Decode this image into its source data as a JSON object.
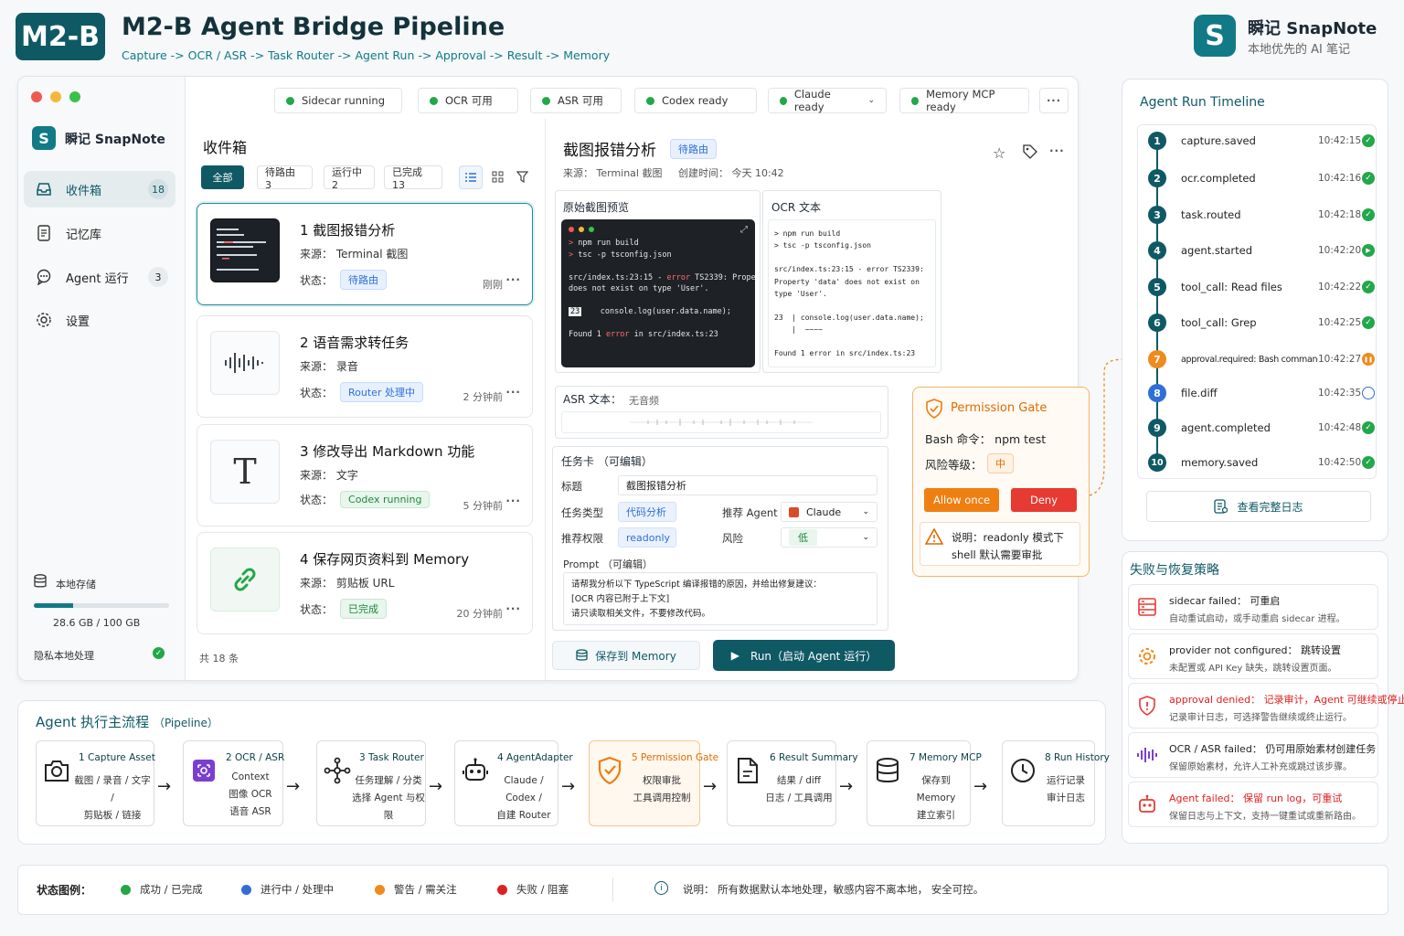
{
  "header": {
    "logo_text": "M2-B",
    "title": "M2-B Agent Bridge Pipeline",
    "subtitle": "Capture -> OCR / ASR -> Task Router -> Agent Run -> Approval -> Result -> Memory",
    "brand_name": "瞬记 SnapNote",
    "brand_tagline": "本地优先的 AI 笔记"
  },
  "status_bar": [
    {
      "label": "Sidecar running",
      "color": "#22a74a"
    },
    {
      "label": "OCR 可用",
      "color": "#22a74a"
    },
    {
      "label": "ASR 可用",
      "color": "#22a74a"
    },
    {
      "label": "Codex ready",
      "color": "#22a74a"
    },
    {
      "label": "Claude ready",
      "color": "#22a74a"
    },
    {
      "label": "Memory MCP ready",
      "color": "#22a74a"
    }
  ],
  "sidebar": {
    "brand": "瞬记 SnapNote",
    "items": [
      {
        "label": "收件箱",
        "count": "18",
        "icon": "inbox-icon"
      },
      {
        "label": "记忆库",
        "count": "",
        "icon": "document-icon"
      },
      {
        "label": "Agent 运行",
        "count": "3",
        "icon": "chat-icon"
      },
      {
        "label": "设置",
        "count": "",
        "icon": "gear-icon"
      }
    ],
    "storage_label": "本地存储",
    "storage_value": "28.6 GB / 100 GB",
    "storage_fraction": 0.29,
    "privacy_label": "隐私本地处理"
  },
  "inbox": {
    "title": "收件箱",
    "filters": [
      "全部",
      "待路由 3",
      "运行中 2",
      "已完成 13"
    ],
    "footer": "共 18 条",
    "items": [
      {
        "title": "1  截图报错分析",
        "source": "来源： Terminal 截图",
        "status_label": "状态：",
        "status": "待路由",
        "time": "刚刚"
      },
      {
        "title": "2  语音需求转任务",
        "source": "来源： 录音",
        "status_label": "状态：",
        "status": "Router 处理中",
        "time": "2 分钟前"
      },
      {
        "title": "3  修改导出 Markdown 功能",
        "source": "来源： 文字",
        "status_label": "状态：",
        "status": "Codex running",
        "time": "5 分钟前"
      },
      {
        "title": "4  保存网页资料到 Memory",
        "source": "来源： 剪贴板 URL",
        "status_label": "状态：",
        "status": "已完成",
        "time": "20 分钟前"
      }
    ]
  },
  "detail": {
    "title": "截图报错分析",
    "badge": "待路由",
    "meta": "来源： Terminal 截图     创建时间： 今天 10:42",
    "preview_title": "原始截图预览",
    "ocr_title": "OCR 文本",
    "terminal_lines": [
      "> npm run build",
      "> tsc -p tsconfig.json",
      "",
      "src/index.ts:23:15 - error TS2339: Property 'data'",
      "does not exist on type 'User'.",
      "",
      "23    console.log(user.data.name);",
      "",
      "Found 1 error in src/index.ts:23"
    ],
    "ocr_lines": [
      "> npm run build",
      "> tsc -p tsconfig.json",
      "",
      "src/index.ts:23:15 - error TS2339:",
      "Property 'data' does not exist on",
      "type 'User'.",
      "",
      "23  | console.log(user.data.name);",
      "    |  ~~~~",
      "",
      "Found 1 error in src/index.ts:23"
    ],
    "asr_label": "ASR 文本：",
    "asr_value": "无音频",
    "task_card_title": "任务卡 （可编辑）",
    "field_title_label": "标题",
    "field_title_value": "截图报错分析",
    "field_type_label": "任务类型",
    "field_type_value": "代码分析",
    "field_agent_label": "推荐 Agent",
    "field_agent_value": "Claude",
    "field_perm_label": "推荐权限",
    "field_perm_value": "readonly",
    "field_risk_label": "风险",
    "field_risk_value": "低",
    "prompt_label": "Prompt （可编辑）",
    "prompt_lines": [
      "请帮我分析以下 TypeScript 编译报错的原因，并给出修复建议：",
      "[OCR 内容已附于上下文]",
      "请只读取相关文件，不要修改代码。"
    ],
    "save_button": "保存到 Memory",
    "run_button": "Run（启动 Agent 运行）"
  },
  "permission_gate": {
    "title": "Permission Gate",
    "bash_label": "Bash 命令：",
    "bash_value": "npm test",
    "risk_label": "风险等级：",
    "risk_value": "中",
    "allow_button": "Allow once",
    "deny_button": "Deny",
    "note_line1": "说明：readonly 模式下",
    "note_line2": "shell 默认需要审批"
  },
  "timeline": {
    "title": "Agent Run Timeline",
    "items": [
      {
        "num": "1",
        "name": "capture.saved",
        "time": "10:42:15",
        "state": "done"
      },
      {
        "num": "2",
        "name": "ocr.completed",
        "time": "10:42:16",
        "state": "done"
      },
      {
        "num": "3",
        "name": "task.routed",
        "time": "10:42:18",
        "state": "done"
      },
      {
        "num": "4",
        "name": "agent.started",
        "time": "10:42:20",
        "state": "playing"
      },
      {
        "num": "5",
        "name": "tool_call: Read files",
        "time": "10:42:22",
        "state": "done"
      },
      {
        "num": "6",
        "name": "tool_call: Grep",
        "time": "10:42:25",
        "state": "done"
      },
      {
        "num": "7",
        "name": "approval.required: Bash command",
        "time": "10:42:27",
        "state": "paused"
      },
      {
        "num": "8",
        "name": "file.diff",
        "time": "10:42:35",
        "state": "pending"
      },
      {
        "num": "9",
        "name": "agent.completed",
        "time": "10:42:48",
        "state": "done"
      },
      {
        "num": "10",
        "name": "memory.saved",
        "time": "10:42:50",
        "state": "done"
      }
    ],
    "view_log_button": "查看完整日志"
  },
  "recovery": {
    "title": "失败与恢复策略",
    "items": [
      {
        "label": "sidecar failed：",
        "value": "可重启",
        "desc": "自动重试启动，或手动重启 sidecar 进程。",
        "color": "#222",
        "icon": "server-icon"
      },
      {
        "label": "provider not configured：",
        "value": "跳转设置",
        "desc": "未配置或 API Key 缺失，跳转设置页面。",
        "color": "#222",
        "icon": "gear-icon"
      },
      {
        "label": "approval denied：",
        "value": "记录审计，Agent 可继续或停止",
        "desc": "记录审计日志，可选择警告继续或终止运行。",
        "color": "#e02020",
        "icon": "shield-icon"
      },
      {
        "label": "OCR / ASR failed：",
        "value": "仍可用原始素材创建任务",
        "desc": "保留原始素材，允许人工补充或跳过该步骤。",
        "color": "#222",
        "icon": "waveform-icon"
      },
      {
        "label": "Agent failed：",
        "value": "保留 run log，可重试",
        "desc": "保留日志与上下文，支持一键重试或重新路由。",
        "color": "#e02020",
        "icon": "robot-icon"
      }
    ]
  },
  "pipeline": {
    "title": "Agent 执行主流程",
    "title_suffix": "（Pipeline）",
    "steps": [
      {
        "head": "1  Capture Asset",
        "lines": [
          "截图 / 录音 / 文字 /",
          "剪贴板 / 链接"
        ],
        "icon": "camera-icon"
      },
      {
        "head": "2  OCR / ASR",
        "lines": [
          "Context",
          "图像 OCR",
          "语音 ASR"
        ],
        "icon": "ocr-icon"
      },
      {
        "head": "3  Task Router",
        "lines": [
          "任务理解 / 分类",
          "选择 Agent 与权限"
        ],
        "icon": "router-icon"
      },
      {
        "head": "4  AgentAdapter",
        "lines": [
          "Claude / Codex /",
          "自建 Router"
        ],
        "icon": "robot-icon"
      },
      {
        "head": "5  Permission Gate",
        "lines": [
          "权限审批",
          "工具调用控制"
        ],
        "icon": "shield-icon"
      },
      {
        "head": "6  Result Summary",
        "lines": [
          "结果 / diff",
          "日志 / 工具调用"
        ],
        "icon": "file-icon"
      },
      {
        "head": "7  Memory MCP",
        "lines": [
          "保存到 Memory",
          "建立索引"
        ],
        "icon": "database-icon"
      },
      {
        "head": "8  Run History",
        "lines": [
          "运行记录",
          "审计日志"
        ],
        "icon": "clock-icon"
      }
    ]
  },
  "legend": {
    "label": "状态图例：",
    "items": [
      {
        "label": "成功 / 已完成",
        "color": "#22a74a"
      },
      {
        "label": "进行中 / 处理中",
        "color": "#2f6fd6"
      },
      {
        "label": "警告 / 需关注",
        "color": "#f08a1c"
      },
      {
        "label": "失败 / 阻塞",
        "color": "#e02020"
      }
    ],
    "note": "说明： 所有数据默认本地处理，敏感内容不离本地， 安全可控。"
  },
  "colors": {
    "accent": "#0f5965",
    "brand": "#117a86",
    "run": "#0f5965",
    "warn": "#f08a1c",
    "danger": "#e8413a"
  }
}
